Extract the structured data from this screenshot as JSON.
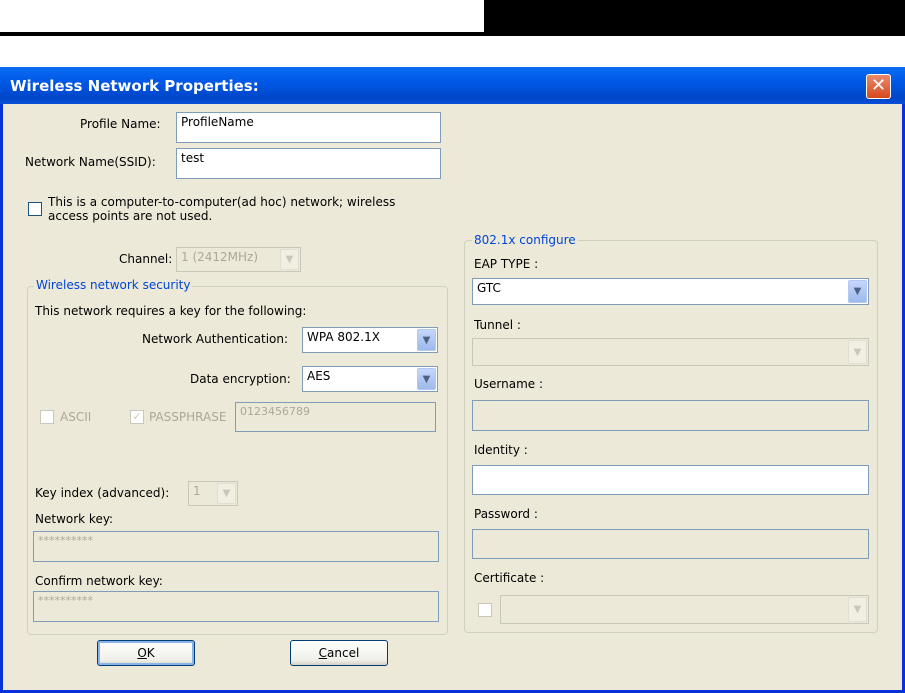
{
  "dialog": {
    "title": "Wireless Network Properties:",
    "close_glyph": "✕"
  },
  "profile": {
    "profile_name_label": "Profile Name:",
    "profile_name_value": "ProfileName",
    "ssid_label": "Network Name(SSID):",
    "ssid_value": "test",
    "adhoc_line1": "This is a computer-to-computer(ad hoc) network; wireless",
    "adhoc_line2": "access points are not used.",
    "adhoc_checked": false,
    "channel_label": "Channel:",
    "channel_value": "1 (2412MHz)"
  },
  "security": {
    "legend": "Wireless network security",
    "requires_text": "This network requires a key for the following:",
    "auth_label": "Network Authentication:",
    "auth_value": "WPA 802.1X",
    "encryption_label": "Data encryption:",
    "encryption_value": "AES",
    "ascii_label": "ASCII",
    "passphrase_label": "PASSPHRASE",
    "passphrase_value": "0123456789",
    "check_glyph": "✓",
    "key_index_label": "Key index (advanced):",
    "key_index_value": "1",
    "network_key_label": "Network key:",
    "network_key_value": "**********",
    "confirm_key_label": "Confirm network key:",
    "confirm_key_value": "**********"
  },
  "dot1x": {
    "legend": "802.1x configure",
    "eap_type_label": "EAP TYPE :",
    "eap_type_value": "GTC",
    "tunnel_label": "Tunnel :",
    "tunnel_value": "",
    "username_label": "Username :",
    "username_value": "",
    "identity_label": "Identity :",
    "identity_value": "",
    "password_label": "Password :",
    "password_value": "",
    "certificate_label": "Certificate :",
    "certificate_value": ""
  },
  "buttons": {
    "ok_accel": "O",
    "ok_rest": "K",
    "cancel_accel": "C",
    "cancel_rest": "ancel"
  },
  "icons": {
    "dropdown": "chevron-down-icon",
    "dropdown_glyph": "▼",
    "close": "close-icon"
  },
  "colors": {
    "titlebar": "#0058e6",
    "dialog_face": "#ece9d8",
    "legend_text": "#0046d5",
    "close_button": "#d7481f"
  }
}
